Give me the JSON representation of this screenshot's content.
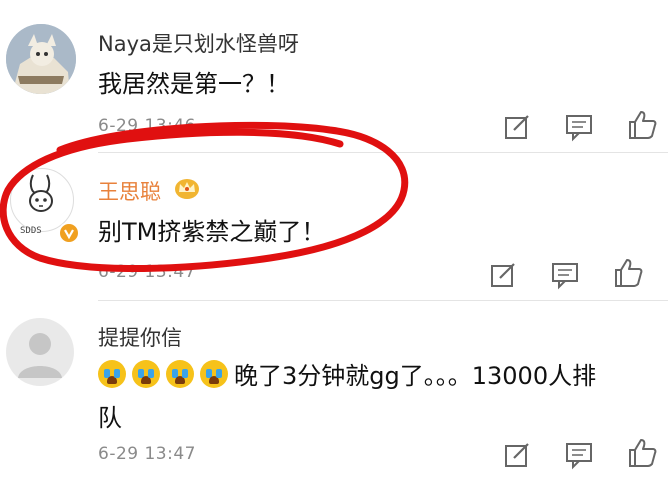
{
  "comments": [
    {
      "user": "Naya是只划水怪兽呀",
      "text": "我居然是第一？！",
      "time": "6-29 13:46"
    },
    {
      "user": "王思聪",
      "text": "别TM挤紫禁之巅了！",
      "time": "6-29 13:47",
      "avatar_caption": "SDDS"
    },
    {
      "user": "提提你信",
      "text_line1": "晚了3分钟就gg了。。。13000人排",
      "text_line2": "队",
      "time": "6-29 13:47"
    }
  ],
  "colors": {
    "vip_name": "#e8813b",
    "highlight_circle": "#e01010",
    "badge": "#f0a020"
  },
  "icons": [
    "edit-icon",
    "comment-icon",
    "thumbs-up-icon",
    "crown-icon",
    "crying-emoji-icon",
    "verified-badge-icon"
  ]
}
